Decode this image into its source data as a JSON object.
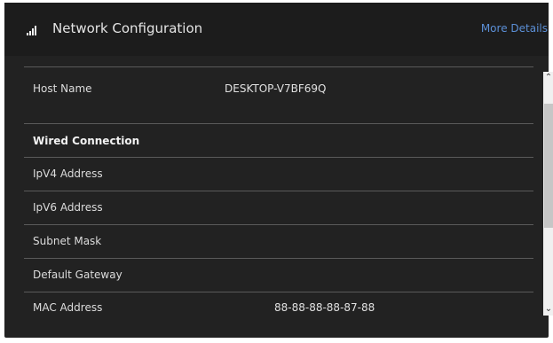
{
  "header": {
    "title": "Network Configuration",
    "more_details": "More Details",
    "icon": "signal-bars-icon"
  },
  "rows": [
    {
      "label": "Host Name",
      "value": "DESKTOP-V7BF69Q"
    },
    {
      "label": "Wired Connection",
      "value": ""
    },
    {
      "label": "IpV4 Address",
      "value": ""
    },
    {
      "label": "IpV6 Address",
      "value": ""
    },
    {
      "label": "Subnet Mask",
      "value": ""
    },
    {
      "label": "Default Gateway",
      "value": ""
    },
    {
      "label": "MAC Address",
      "value": "88-88-88-88-87-88"
    }
  ],
  "colors": {
    "panel": "#222222",
    "header": "#1c1c1c",
    "link": "#5b8fd6",
    "divider": "#5a5a5a"
  }
}
